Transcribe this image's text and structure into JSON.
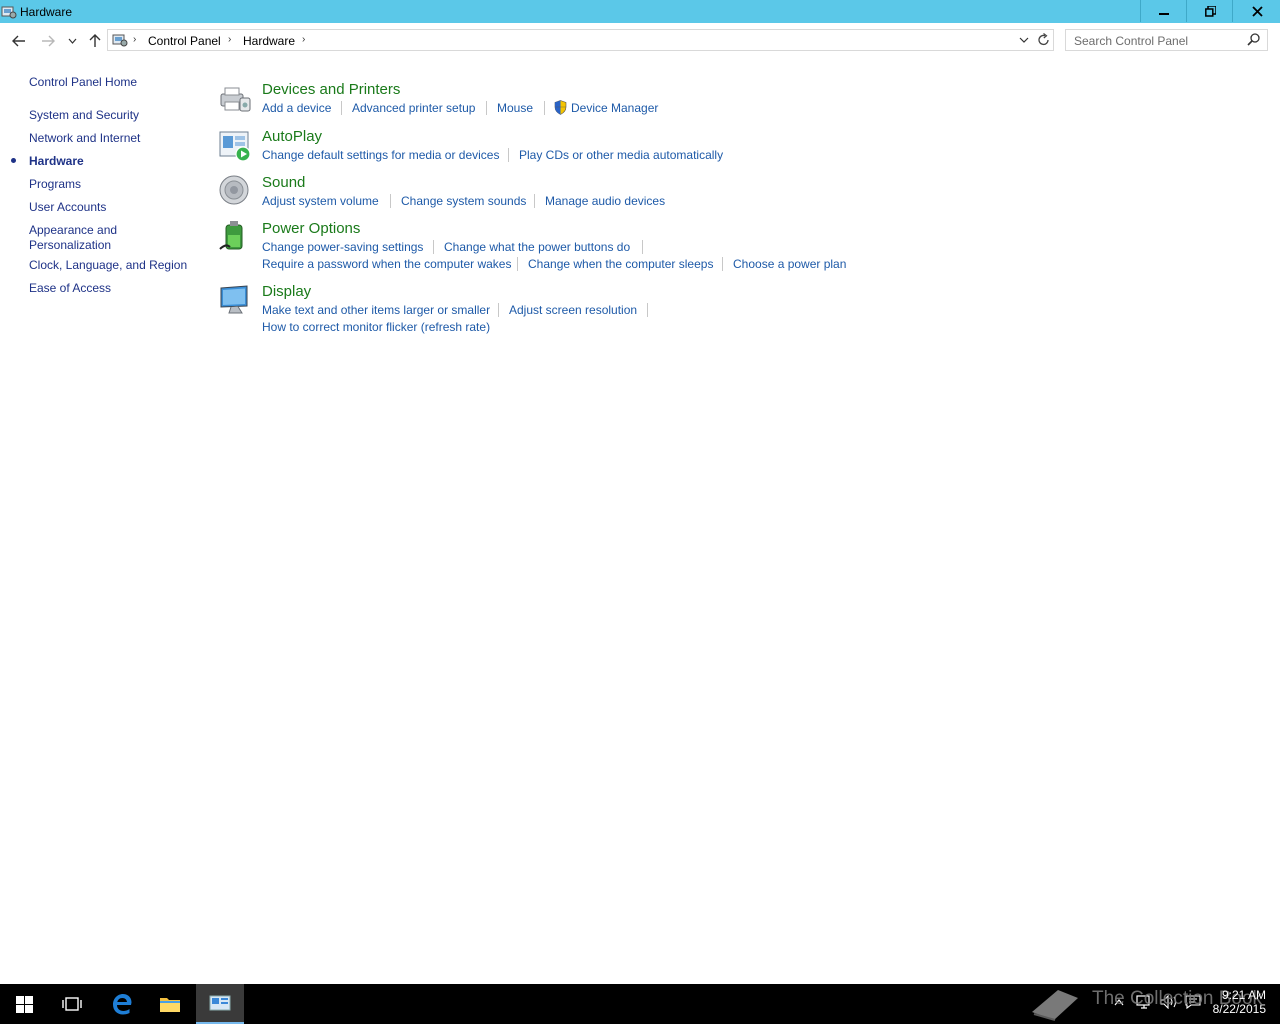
{
  "window": {
    "title": "Hardware"
  },
  "breadcrumb": {
    "items": [
      "Control Panel",
      "Hardware"
    ]
  },
  "search": {
    "placeholder": "Search Control Panel"
  },
  "leftnav": {
    "home": "Control Panel Home",
    "items": [
      "System and Security",
      "Network and Internet",
      "Hardware",
      "Programs",
      "User Accounts",
      "Appearance and",
      "Personalization",
      "Clock, Language, and Region",
      "Ease of Access"
    ],
    "current_index": 2
  },
  "categories": {
    "devices": {
      "title": "Devices and Printers",
      "links": [
        "Add a device",
        "Advanced printer setup",
        "Mouse",
        "Device Manager"
      ]
    },
    "autoplay": {
      "title": "AutoPlay",
      "links": [
        "Change default settings for media or devices",
        "Play CDs or other media automatically"
      ]
    },
    "sound": {
      "title": "Sound",
      "links": [
        "Adjust system volume",
        "Change system sounds",
        "Manage audio devices"
      ]
    },
    "power": {
      "title": "Power Options",
      "links": [
        "Change power-saving settings",
        "Change what the power buttons do",
        "Require a password when the computer wakes",
        "Change when the computer sleeps",
        "Choose a power plan"
      ]
    },
    "display": {
      "title": "Display",
      "links": [
        "Make text and other items larger or smaller",
        "Adjust screen resolution",
        "How to correct monitor flicker (refresh rate)"
      ]
    }
  },
  "taskbar": {
    "time": "9:21 AM",
    "date": "8/22/2015",
    "watermark": "The Collection Book"
  },
  "colors": {
    "titlebar": "#5bc8e8",
    "link": "#1e5aa8",
    "category_title": "#1a7a1a",
    "taskbar": "#000000"
  }
}
